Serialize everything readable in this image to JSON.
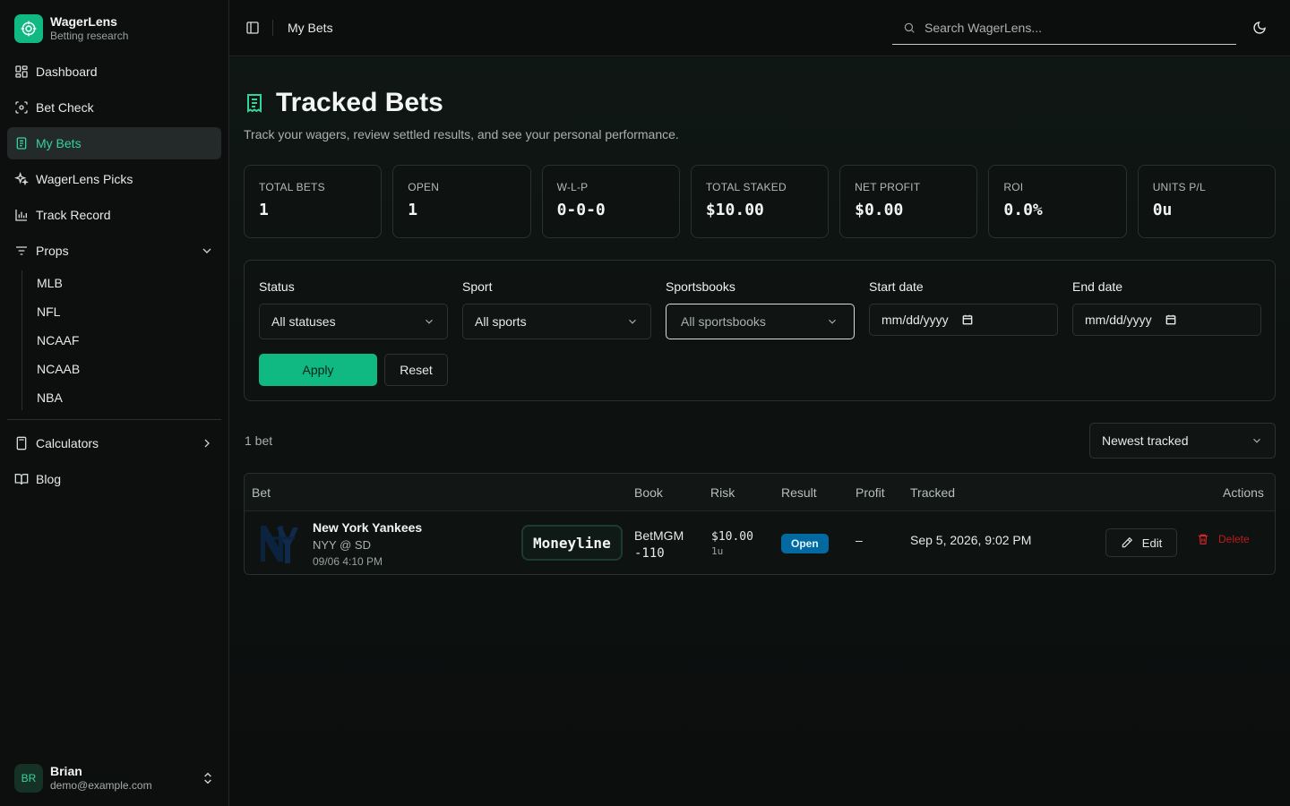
{
  "brand": {
    "name": "WagerLens",
    "tagline": "Betting research",
    "accent": "#10b981"
  },
  "sidebar": {
    "items": [
      {
        "label": "Dashboard",
        "icon": "grid-icon"
      },
      {
        "label": "Bet Check",
        "icon": "scan-icon"
      },
      {
        "label": "My Bets",
        "icon": "receipt-icon",
        "active": true
      },
      {
        "label": "WagerLens Picks",
        "icon": "sparkles-icon"
      },
      {
        "label": "Track Record",
        "icon": "bar-chart-icon"
      },
      {
        "label": "Props",
        "icon": "filter-lines-icon",
        "expanded": true
      }
    ],
    "props_sub": [
      "MLB",
      "NFL",
      "NCAAF",
      "NCAAB",
      "NBA"
    ],
    "bottom_items": [
      {
        "label": "Calculators",
        "icon": "calculator-icon"
      },
      {
        "label": "Blog",
        "icon": "book-icon"
      }
    ]
  },
  "user": {
    "initials": "BR",
    "name": "Brian",
    "email": "demo@example.com"
  },
  "header": {
    "breadcrumb": "My Bets",
    "search_placeholder": "Search WagerLens..."
  },
  "page": {
    "title": "Tracked Bets",
    "subtitle": "Track your wagers, review settled results, and see your personal performance."
  },
  "stats": [
    {
      "label": "TOTAL BETS",
      "value": "1"
    },
    {
      "label": "OPEN",
      "value": "1"
    },
    {
      "label": "W-L-P",
      "value": "0-0-0"
    },
    {
      "label": "TOTAL STAKED",
      "value": "$10.00"
    },
    {
      "label": "NET PROFIT",
      "value": "$0.00"
    },
    {
      "label": "ROI",
      "value": "0.0%"
    },
    {
      "label": "UNITS P/L",
      "value": "0u"
    }
  ],
  "filters": {
    "status": {
      "label": "Status",
      "value": "All statuses"
    },
    "sport": {
      "label": "Sport",
      "value": "All sports"
    },
    "sportsbooks": {
      "label": "Sportsbooks",
      "value": "All sportsbooks"
    },
    "start_date": {
      "label": "Start date",
      "value": "mm/dd/yyyy"
    },
    "end_date": {
      "label": "End date",
      "value": "mm/dd/yyyy"
    },
    "apply_label": "Apply",
    "reset_label": "Reset"
  },
  "results": {
    "count": "1 bet",
    "sort": "Newest tracked"
  },
  "table": {
    "headers": [
      "Bet",
      "Book",
      "Risk",
      "Result",
      "Profit",
      "Tracked",
      "Actions"
    ],
    "rows": [
      {
        "team": "New York Yankees",
        "matchup": "NYY @ SD",
        "game_time": "09/06 4:10 PM",
        "market": "Moneyline",
        "book": "BetMGM",
        "odds": "-110",
        "risk": "$10.00",
        "units": "1u",
        "result": "Open",
        "profit": "–",
        "tracked": "Sep 5, 2026, 9:02 PM",
        "edit_label": "Edit",
        "delete_label": "Delete"
      }
    ]
  },
  "colors": {
    "open_badge": "#0369a1",
    "delete": "#dc2626",
    "team": "#0c2340"
  }
}
